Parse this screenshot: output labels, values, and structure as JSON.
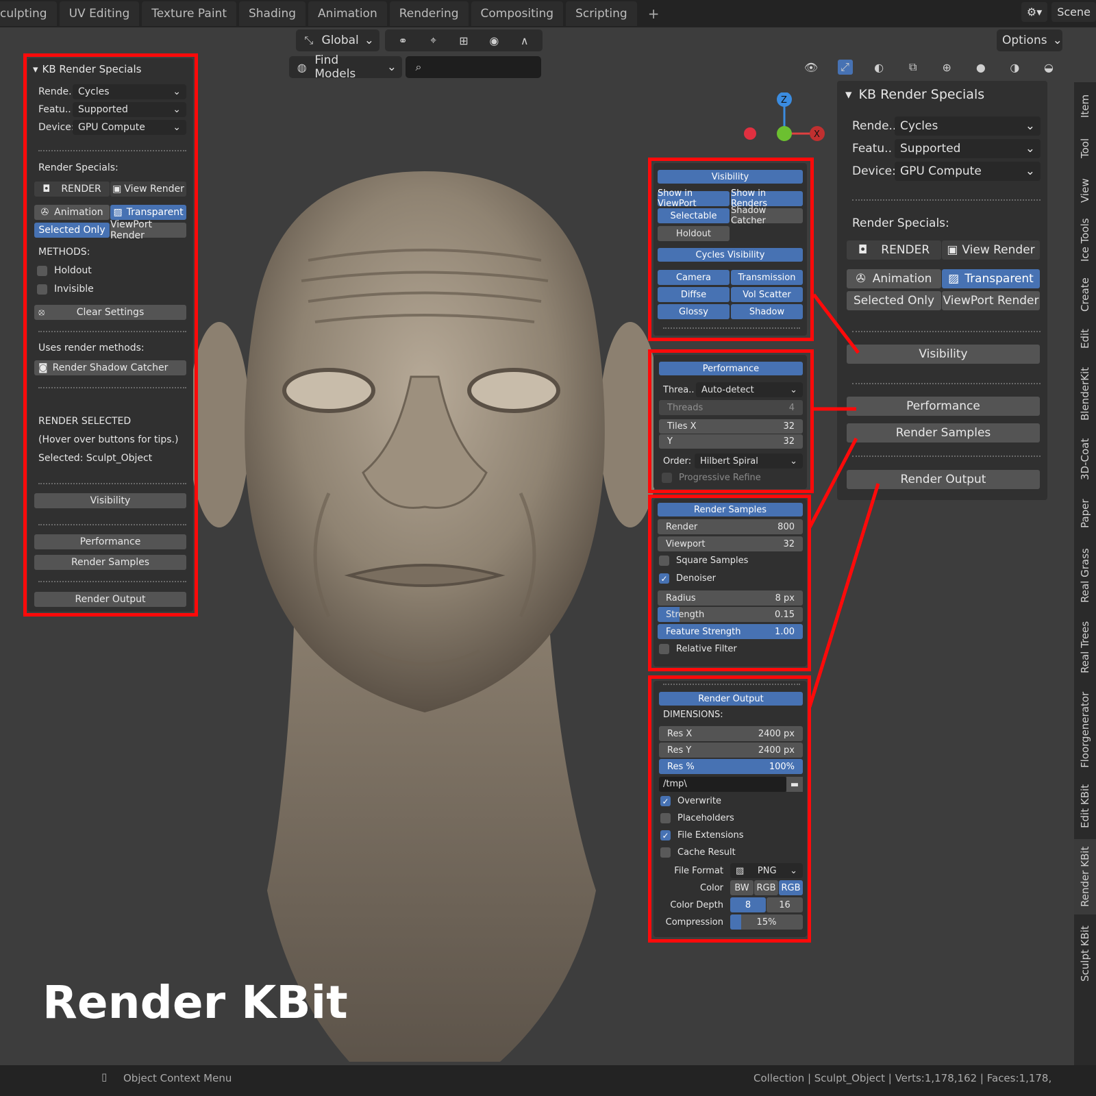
{
  "topbar": {
    "tabs": [
      "culpting",
      "UV Editing",
      "Texture Paint",
      "Shading",
      "Animation",
      "Rendering",
      "Compositing",
      "Scripting",
      "+"
    ],
    "scene": "Scene"
  },
  "header": {
    "transform": "Global",
    "find": "Find Models",
    "options": "Options"
  },
  "sidebar_tabs": [
    "Item",
    "Tool",
    "View",
    "Ice Tools",
    "Create",
    "Edit",
    "BlenderKit",
    "3D-Coat",
    "Paper",
    "Real Grass",
    "Real Trees",
    "Floorgenerator",
    "Edit KBit",
    "Render KBit",
    "Sculpt KBit"
  ],
  "left_panel": {
    "title": "KB Render Specials",
    "render_label": "Rende..",
    "render_value": "Cycles",
    "feature_label": "Featu..",
    "feature_value": "Supported",
    "device_label": "Device:",
    "device_value": "GPU Compute",
    "render_specials": "Render Specials:",
    "render_btn": "RENDER",
    "view_render_btn": "View Render",
    "animation_btn": "Animation",
    "transparent_btn": "Transparent",
    "selected_only_btn": "Selected Only",
    "viewport_render_btn": "ViewPort Render",
    "methods": "METHODS:",
    "holdout": "Holdout",
    "invisible": "Invisible",
    "clear_settings": "Clear Settings",
    "uses_methods": "Uses render methods:",
    "shadow_catcher": "Render Shadow Catcher",
    "render_selected": "RENDER SELECTED",
    "hover_tip": "(Hover over buttons for tips.)",
    "selected": "Selected: Sculpt_Object",
    "visibility": "Visibility",
    "performance": "Performance",
    "render_samples": "Render Samples",
    "render_output": "Render Output"
  },
  "right_panel": {
    "title": "KB Render Specials",
    "render_label": "Rende..",
    "render_value": "Cycles",
    "feature_label": "Featu..",
    "feature_value": "Supported",
    "device_label": "Device:",
    "device_value": "GPU Compute",
    "render_specials": "Render Specials:",
    "render_btn": "RENDER",
    "view_render_btn": "View Render",
    "animation_btn": "Animation",
    "transparent_btn": "Transparent",
    "selected_only_btn": "Selected Only",
    "viewport_render_btn": "ViewPort Render",
    "visibility": "Visibility",
    "performance": "Performance",
    "render_samples": "Render Samples",
    "render_output": "Render Output"
  },
  "visibility_panel": {
    "title": "Visibility",
    "show_viewport": "Show in ViewPort",
    "show_renders": "Show in Renders",
    "selectable": "Selectable",
    "shadow_catcher": "Shadow Catcher",
    "holdout": "Holdout",
    "cycles_title": "Cycles Visibility",
    "camera": "Camera",
    "transmission": "Transmission",
    "diffse": "Diffse",
    "vol_scatter": "Vol Scatter",
    "glossy": "Glossy",
    "shadow": "Shadow"
  },
  "performance_panel": {
    "title": "Performance",
    "threads_label": "Threa..",
    "threads_mode": "Auto-detect",
    "threads": "Threads",
    "threads_value": "4",
    "tiles_x": "Tiles X",
    "tiles_x_value": "32",
    "tiles_y": "Y",
    "tiles_y_value": "32",
    "order_label": "Order:",
    "order_value": "Hilbert Spiral",
    "progressive": "Progressive Refine"
  },
  "samples_panel": {
    "title": "Render Samples",
    "render": "Render",
    "render_value": "800",
    "viewport": "Viewport",
    "viewport_value": "32",
    "square": "Square Samples",
    "denoiser": "Denoiser",
    "radius": "Radius",
    "radius_value": "8 px",
    "strength": "Strength",
    "strength_value": "0.15",
    "strength_fraction": 0.15,
    "feature_strength": "Feature Strength",
    "feature_strength_value": "1.00",
    "relative": "Relative Filter"
  },
  "output_panel": {
    "title": "Render Output",
    "dimensions": "DIMENSIONS:",
    "res_x": "Res X",
    "res_x_value": "2400 px",
    "res_y": "Res Y",
    "res_y_value": "2400 px",
    "res_pct": "Res %",
    "res_pct_value": "100%",
    "path": "/tmp\\",
    "overwrite": "Overwrite",
    "placeholders": "Placeholders",
    "file_ext": "File Extensions",
    "cache": "Cache Result",
    "file_format_label": "File Format",
    "file_format": "PNG",
    "color_label": "Color",
    "color_bw": "BW",
    "color_rgb": "RGB",
    "color_rgba": "RGB",
    "depth_label": "Color Depth",
    "depth_8": "8",
    "depth_16": "16",
    "compression_label": "Compression",
    "compression_value": "15%",
    "compression_fraction": 0.15
  },
  "overlay_title": "Render KBit",
  "status": {
    "left": "Object Context Menu",
    "right": "Collection | Sculpt_Object | Verts:1,178,162 | Faces:1,178,"
  },
  "colors": {
    "accent": "#4772b3",
    "highlight": "#ff0a0a",
    "bg": "#3d3d3d"
  }
}
